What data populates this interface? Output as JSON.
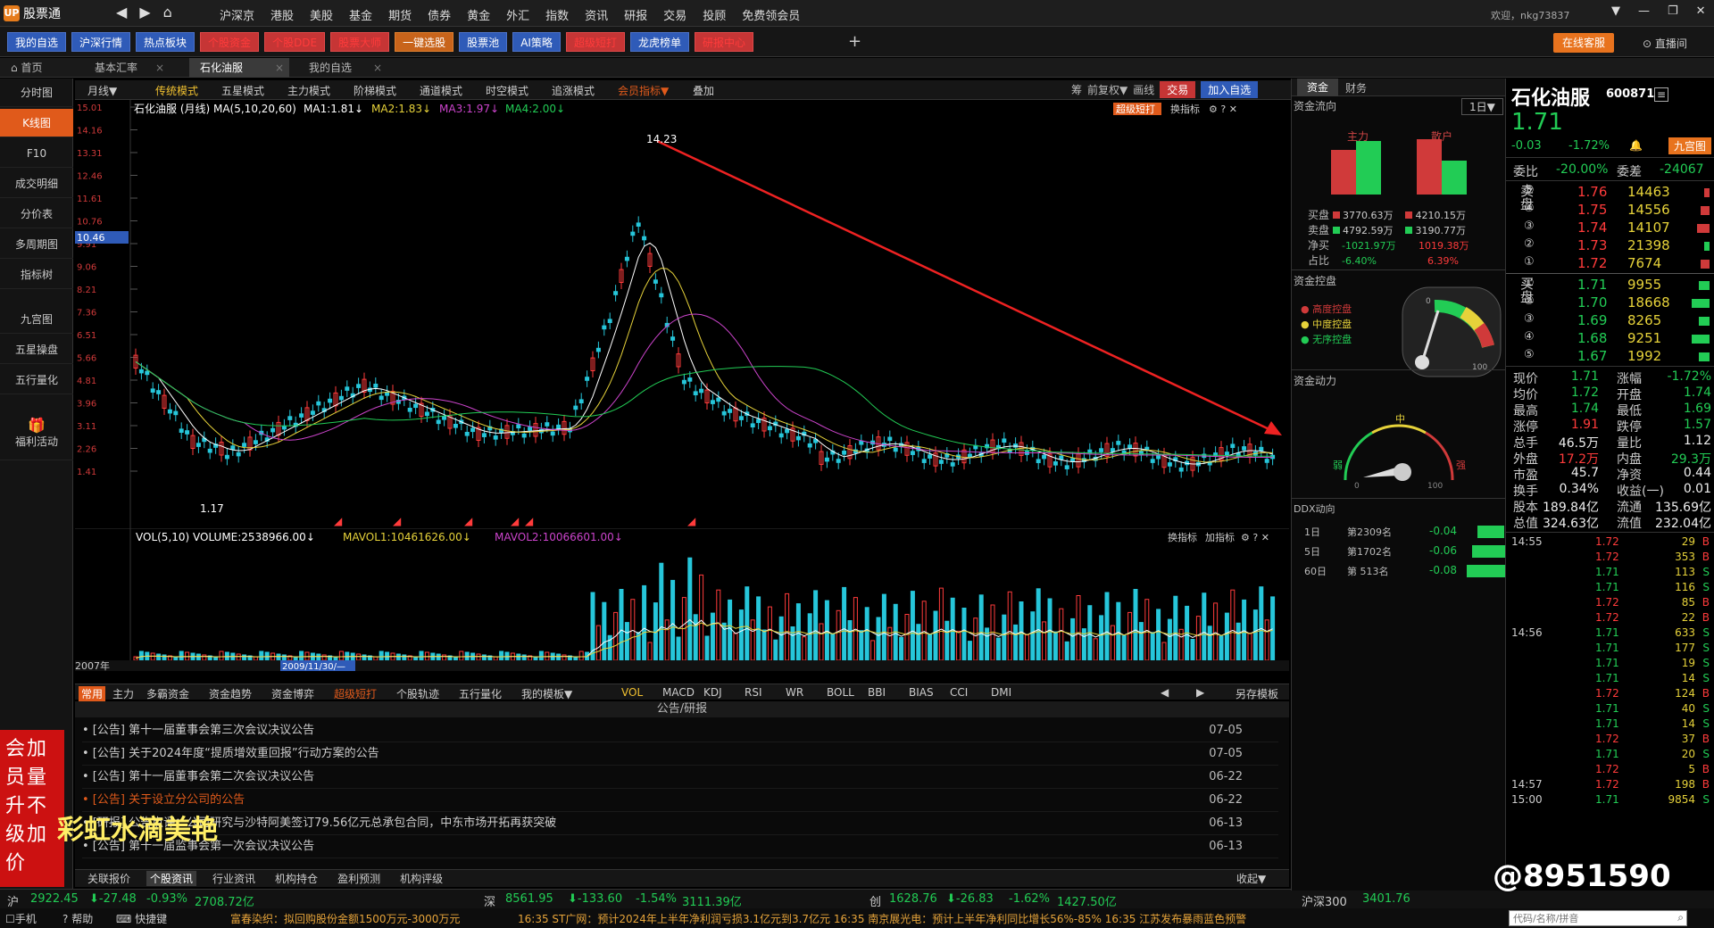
{
  "app": {
    "name": "股票通",
    "user": "欢迎，nkg73837"
  },
  "nav": {
    "menu": [
      "沪深京",
      "港股",
      "美股",
      "基金",
      "期货",
      "债券",
      "黄金",
      "外汇",
      "指数",
      "资讯",
      "研报",
      "交易",
      "投顾",
      "免费领会员"
    ]
  },
  "toolbar": {
    "buttons": [
      "我的自选",
      "沪深行情",
      "热点板块",
      "个股资金",
      "个股DDE",
      "股票大师",
      "一键选股",
      "股票池",
      "AI策略",
      "超级短打",
      "龙虎榜单",
      "研报中心"
    ],
    "online_service": "在线客服",
    "live": "直播间"
  },
  "tabs": [
    {
      "label": "首页"
    },
    {
      "label": "基本汇率"
    },
    {
      "label": "石化油服"
    },
    {
      "label": "我的自选"
    }
  ],
  "sidebar": {
    "items": [
      "分时图",
      "K线图",
      "F10",
      "成交明细",
      "分价表",
      "多周期图",
      "指标树",
      "九宫图",
      "五星操盘",
      "五行量化",
      "福利活动"
    ]
  },
  "chart_toolbar": {
    "period": "月线▼",
    "modes": [
      "传统模式",
      "五星模式",
      "主力模式",
      "阶梯模式",
      "通道模式",
      "时空模式",
      "追涨模式",
      "会员指标▼",
      "叠加"
    ],
    "right": [
      "筹",
      "前复权▼",
      "画线",
      "交易",
      "加入自选"
    ],
    "super": "超级短打",
    "switch": "换指标"
  },
  "kline": {
    "header": "石化油服 (月线) MA(5,10,20,60)",
    "ma1": "MA1:1.81↓",
    "ma2": "MA2:1.83↓",
    "ma3": "MA3:1.97↓",
    "ma4": "MA4:2.00↓",
    "high_label": "14.23",
    "low_label": "1.17",
    "current_price_tag": "10.46",
    "y_ticks": [
      "15.01",
      "14.16",
      "13.31",
      "12.46",
      "11.61",
      "10.76",
      "9.91",
      "9.06",
      "8.21",
      "7.36",
      "6.51",
      "5.66",
      "4.81",
      "3.96",
      "3.11",
      "2.26",
      "1.41"
    ]
  },
  "volume": {
    "header": "VOL(5,10)",
    "volume": "VOLUME:2538966.00↓",
    "mavol1": "MAVOL1:10461626.00↓",
    "mavol2": "MAVOL2:10066601.00↓",
    "year_label": "2007年",
    "date_label": "2009/11/30/—",
    "right": [
      "换指标",
      "加指标"
    ]
  },
  "indicators": {
    "left": [
      "常用",
      "主力",
      "多霸资金",
      "资金趋势",
      "资金博弈",
      "超级短打",
      "个股轨迹",
      "五行量化",
      "我的模板▼"
    ],
    "items": [
      "VOL",
      "MACD",
      "KDJ",
      "RSI",
      "WR",
      "BOLL",
      "BBI",
      "BIAS",
      "CCI",
      "DMI"
    ],
    "other": "另存模板"
  },
  "news": {
    "title": "公告/研报",
    "items": [
      {
        "text": "• [公告] 第十一届董事会第三次会议决议公告",
        "date": "07-05"
      },
      {
        "text": "• [公告] 关于2024年度“提质增效重回报”行动方案的公告",
        "date": "07-05"
      },
      {
        "text": "• [公告] 第十一届董事会第二次会议决议公告",
        "date": "06-22"
      },
      {
        "text": "• [公告] 关于设立分公司的公告",
        "date": "06-22"
      },
      {
        "text": "• [研报] 公告点评：公司研究与沙特阿美签订79.56亿元总承包合同，中东市场开拓再获突破",
        "date": "06-13"
      },
      {
        "text": "• [公告] 第十一届监事会第一次会议决议公告",
        "date": "06-13"
      }
    ],
    "tabs": [
      "关联报价",
      "个股资讯",
      "行业资讯",
      "机构持仓",
      "盈利预测",
      "机构评级"
    ],
    "collapse": "收起▼"
  },
  "promo": {
    "text": "会加员量升不级加价",
    "overlay": "彩虹水滴美艳"
  },
  "status": {
    "sh_label": "沪",
    "sh": "2922.45",
    "sh_chg": "-27.48",
    "sh_pct": "-0.93%",
    "sh_amt": "2708.72亿",
    "sz_label": "深",
    "sz": "8561.95",
    "sz_chg": "-133.60",
    "sz_pct": "-1.54%",
    "sz_amt": "3111.39亿",
    "cy_label": "创",
    "cy": "1628.76",
    "cy_chg": "-26.83",
    "cy_pct": "-1.62%",
    "cy_amt": "1427.50亿",
    "hs_label": "沪深300",
    "hs": "3401.76",
    "ticker": "16:35 ST广网：预计2024年上半年净利润亏损3.1亿元到3.7亿元    16:35 南京展光电：预计上半年净利同比增长56%-85%    16:35 江苏发布暴雨蓝色预警",
    "prev": "富春染织：拟回购股份金额1500万元-3000万元",
    "search_placeholder": "代码/名称/拼音",
    "phone": "手机",
    "help": "帮助",
    "speed": "快捷键"
  },
  "fund": {
    "tabs": [
      "资金",
      "财务"
    ],
    "flow": "资金流向",
    "period": "1日▼",
    "zhuli": "主力",
    "sanhu": "散户",
    "buy": "买盘",
    "buy_zl": "3770.63万",
    "buy_sh": "4210.15万",
    "sell": "卖盘",
    "sell_zl": "4792.59万",
    "sell_sh": "3190.77万",
    "net": "净买",
    "net_zl": "-1021.97万",
    "net_sh": "1019.38万",
    "ratio": "占比",
    "ratio_zl": "-6.40%",
    "ratio_sh": "6.39%",
    "control": "资金控盘",
    "ctl_items": [
      "高度控盘",
      "中度控盘",
      "无序控盘"
    ],
    "gauge_min": "0",
    "gauge_max": "100",
    "power": "资金动力",
    "mid": "中",
    "weak": "弱",
    "strong": "强",
    "ddx": "DDX动向",
    "ddx_rows": [
      {
        "p": "1日",
        "r": "第2309名",
        "v": "-0.04"
      },
      {
        "p": "5日",
        "r": "第1702名",
        "v": "-0.06"
      },
      {
        "p": "60日",
        "r": "第 513名",
        "v": "-0.08"
      }
    ]
  },
  "quote": {
    "name": "石化油服",
    "code": "600871",
    "price": "1.71",
    "chg": "-0.03",
    "pct": "-1.72%",
    "nine": "九宫图",
    "wb_label": "委比",
    "wb": "-20.00%",
    "wc_label": "委差",
    "wc": "-24067",
    "asks": [
      {
        "n": "⑤",
        "p": "1.76",
        "v": "14463"
      },
      {
        "n": "④",
        "p": "1.75",
        "v": "14556"
      },
      {
        "n": "③",
        "p": "1.74",
        "v": "14107"
      },
      {
        "n": "②",
        "p": "1.73",
        "v": "21398"
      },
      {
        "n": "①",
        "p": "1.72",
        "v": "7674"
      }
    ],
    "bids": [
      {
        "n": "①",
        "p": "1.71",
        "v": "9955"
      },
      {
        "n": "②",
        "p": "1.70",
        "v": "18668"
      },
      {
        "n": "③",
        "p": "1.69",
        "v": "8265"
      },
      {
        "n": "④",
        "p": "1.68",
        "v": "9251"
      },
      {
        "n": "⑤",
        "p": "1.67",
        "v": "1992"
      }
    ],
    "sell_label": "卖盘",
    "buy_label": "买盘",
    "stats": [
      {
        "l1": "现价",
        "v1": "1.71",
        "l2": "涨幅",
        "v2": "-1.72%"
      },
      {
        "l1": "均价",
        "v1": "1.72",
        "l2": "开盘",
        "v2": "1.74"
      },
      {
        "l1": "最高",
        "v1": "1.74",
        "l2": "最低",
        "v2": "1.69"
      },
      {
        "l1": "涨停",
        "v1": "1.91",
        "l2": "跌停",
        "v2": "1.57"
      },
      {
        "l1": "总手",
        "v1": "46.5万",
        "l2": "量比",
        "v2": "1.12"
      },
      {
        "l1": "外盘",
        "v1": "17.2万",
        "l2": "内盘",
        "v2": "29.3万"
      },
      {
        "l1": "市盈",
        "v1": "45.7",
        "l2": "净资",
        "v2": "0.44"
      },
      {
        "l1": "换手",
        "v1": "0.34%",
        "l2": "收益(一)",
        "v2": "0.01"
      },
      {
        "l1": "股本",
        "v1": "189.84亿",
        "l2": "流通",
        "v2": "135.69亿"
      },
      {
        "l1": "总值",
        "v1": "324.63亿",
        "l2": "流值",
        "v2": "232.04亿"
      }
    ],
    "ticks": [
      {
        "t": "14:55",
        "p": "1.72",
        "v": "29",
        "s": "B"
      },
      {
        "t": "",
        "p": "1.72",
        "v": "353",
        "s": "B"
      },
      {
        "t": "",
        "p": "1.71",
        "v": "113",
        "s": "S"
      },
      {
        "t": "",
        "p": "1.71",
        "v": "116",
        "s": "S"
      },
      {
        "t": "",
        "p": "1.72",
        "v": "85",
        "s": "B"
      },
      {
        "t": "",
        "p": "1.72",
        "v": "22",
        "s": "B"
      },
      {
        "t": "14:56",
        "p": "1.71",
        "v": "633",
        "s": "S"
      },
      {
        "t": "",
        "p": "1.71",
        "v": "177",
        "s": "S"
      },
      {
        "t": "",
        "p": "1.71",
        "v": "19",
        "s": "S"
      },
      {
        "t": "",
        "p": "1.71",
        "v": "14",
        "s": "S"
      },
      {
        "t": "",
        "p": "1.72",
        "v": "124",
        "s": "B"
      },
      {
        "t": "",
        "p": "1.71",
        "v": "40",
        "s": "S"
      },
      {
        "t": "",
        "p": "1.71",
        "v": "14",
        "s": "S"
      },
      {
        "t": "",
        "p": "1.72",
        "v": "37",
        "s": "B"
      },
      {
        "t": "",
        "p": "1.71",
        "v": "20",
        "s": "S"
      },
      {
        "t": "",
        "p": "1.72",
        "v": "5",
        "s": "B"
      },
      {
        "t": "14:57",
        "p": "1.72",
        "v": "198",
        "s": "B"
      },
      {
        "t": "15:00",
        "p": "1.71",
        "v": "9854",
        "s": "S"
      }
    ]
  },
  "watermark": "@8951590"
}
